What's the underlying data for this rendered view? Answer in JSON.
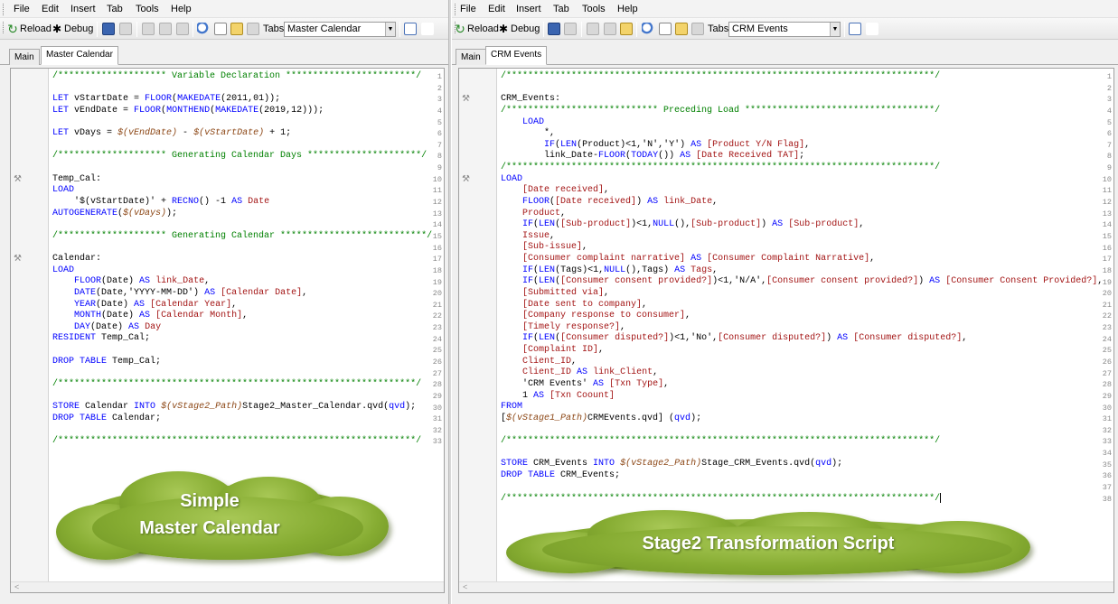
{
  "menu": [
    "File",
    "Edit",
    "Insert",
    "Tab",
    "Tools",
    "Help"
  ],
  "toolbar": {
    "reload_label": "Reload",
    "debug_label": "Debug",
    "tabs_label": "Tabs"
  },
  "left": {
    "combo_value": "Master Calendar",
    "tabs": [
      "Main",
      "Master Calendar"
    ],
    "active_tab": 1,
    "callout": {
      "line1": "Simple",
      "line2": "Master Calendar"
    },
    "wrench_lines": [
      10,
      17
    ],
    "lines": [
      [
        [
          "cm",
          "/******************** Variable Declaration ************************/"
        ]
      ],
      [],
      [
        [
          "kw",
          "LET"
        ],
        [
          "t",
          " vStartDate = "
        ],
        [
          "fn",
          "FLOOR"
        ],
        [
          "t",
          "("
        ],
        [
          "fn",
          "MAKEDATE"
        ],
        [
          "t",
          "(2011,01));"
        ]
      ],
      [
        [
          "kw",
          "LET"
        ],
        [
          "t",
          " vEndDate = "
        ],
        [
          "fn",
          "FLOOR"
        ],
        [
          "t",
          "("
        ],
        [
          "fn",
          "MONTHEND"
        ],
        [
          "t",
          "("
        ],
        [
          "fn",
          "MAKEDATE"
        ],
        [
          "t",
          "(2019,12)));"
        ]
      ],
      [],
      [
        [
          "kw",
          "LET"
        ],
        [
          "t",
          " vDays = "
        ],
        [
          "vr",
          "$(vEndDate)"
        ],
        [
          "t",
          " - "
        ],
        [
          "vr",
          "$(vStartDate)"
        ],
        [
          "t",
          " + 1;"
        ]
      ],
      [],
      [
        [
          "cm",
          "/******************** Generating Calendar Days *********************/"
        ]
      ],
      [],
      [
        [
          "t",
          "Temp_Cal:"
        ]
      ],
      [
        [
          "kw",
          "LOAD"
        ]
      ],
      [
        [
          "t",
          "    '$(vStartDate)' + "
        ],
        [
          "fn",
          "RECNO"
        ],
        [
          "t",
          "() -1 "
        ],
        [
          "kw",
          "AS"
        ],
        [
          "t",
          " "
        ],
        [
          "fld",
          "Date"
        ]
      ],
      [
        [
          "kw",
          "AUTOGENERATE"
        ],
        [
          "t",
          "("
        ],
        [
          "vr",
          "$(vDays)"
        ],
        [
          "t",
          ");"
        ]
      ],
      [],
      [
        [
          "cm",
          "/******************** Generating Calendar ***************************/"
        ]
      ],
      [],
      [
        [
          "t",
          "Calendar:"
        ]
      ],
      [
        [
          "kw",
          "LOAD"
        ]
      ],
      [
        [
          "t",
          "    "
        ],
        [
          "fn",
          "FLOOR"
        ],
        [
          "t",
          "(Date) "
        ],
        [
          "kw",
          "AS"
        ],
        [
          "t",
          " "
        ],
        [
          "fld",
          "link_Date"
        ],
        [
          "t",
          ","
        ]
      ],
      [
        [
          "t",
          "    "
        ],
        [
          "fn",
          "DATE"
        ],
        [
          "t",
          "(Date,'YYYY-MM-DD') "
        ],
        [
          "kw",
          "AS"
        ],
        [
          "t",
          " "
        ],
        [
          "fld",
          "[Calendar Date]"
        ],
        [
          "t",
          ","
        ]
      ],
      [
        [
          "t",
          "    "
        ],
        [
          "fn",
          "YEAR"
        ],
        [
          "t",
          "(Date) "
        ],
        [
          "kw",
          "AS"
        ],
        [
          "t",
          " "
        ],
        [
          "fld",
          "[Calendar Year]"
        ],
        [
          "t",
          ","
        ]
      ],
      [
        [
          "t",
          "    "
        ],
        [
          "fn",
          "MONTH"
        ],
        [
          "t",
          "(Date) "
        ],
        [
          "kw",
          "AS"
        ],
        [
          "t",
          " "
        ],
        [
          "fld",
          "[Calendar Month]"
        ],
        [
          "t",
          ","
        ]
      ],
      [
        [
          "t",
          "    "
        ],
        [
          "fn",
          "DAY"
        ],
        [
          "t",
          "(Date) "
        ],
        [
          "kw",
          "AS"
        ],
        [
          "t",
          " "
        ],
        [
          "fld",
          "Day"
        ]
      ],
      [
        [
          "kw",
          "RESIDENT"
        ],
        [
          "t",
          " Temp_Cal;"
        ]
      ],
      [],
      [
        [
          "kw",
          "DROP TABLE"
        ],
        [
          "t",
          " Temp_Cal;"
        ]
      ],
      [],
      [
        [
          "cm",
          "/******************************************************************/"
        ]
      ],
      [],
      [
        [
          "kw",
          "STORE"
        ],
        [
          "t",
          " Calendar "
        ],
        [
          "kw",
          "INTO"
        ],
        [
          "t",
          " "
        ],
        [
          "vr",
          "$(vStage2_Path)"
        ],
        [
          "t",
          "Stage2_Master_Calendar.qvd("
        ],
        [
          "kw",
          "qvd"
        ],
        [
          "t",
          ");"
        ]
      ],
      [
        [
          "kw",
          "DROP TABLE"
        ],
        [
          "t",
          " Calendar;"
        ]
      ],
      [],
      [
        [
          "cm",
          "/******************************************************************/"
        ]
      ]
    ]
  },
  "right": {
    "combo_value": "CRM Events",
    "tabs": [
      "Main",
      "CRM Events"
    ],
    "active_tab": 1,
    "callout": {
      "line1": "Stage2 Transformation Script"
    },
    "wrench_lines": [
      3,
      10
    ],
    "lines": [
      [
        [
          "cm",
          "/*******************************************************************************/"
        ]
      ],
      [],
      [
        [
          "t",
          "CRM_Events:"
        ]
      ],
      [
        [
          "cm",
          "/**************************** Preceding Load ***********************************/"
        ]
      ],
      [
        [
          "t",
          "    "
        ],
        [
          "kw",
          "LOAD"
        ]
      ],
      [
        [
          "t",
          "        *,"
        ]
      ],
      [
        [
          "t",
          "        "
        ],
        [
          "fn",
          "IF"
        ],
        [
          "t",
          "("
        ],
        [
          "fn",
          "LEN"
        ],
        [
          "t",
          "(Product)<1,'N','Y') "
        ],
        [
          "kw",
          "AS"
        ],
        [
          "t",
          " "
        ],
        [
          "fld",
          "[Product Y/N Flag]"
        ],
        [
          "t",
          ","
        ]
      ],
      [
        [
          "t",
          "        link_Date-"
        ],
        [
          "fn",
          "FLOOR"
        ],
        [
          "t",
          "("
        ],
        [
          "fn",
          "TODAY"
        ],
        [
          "t",
          "()) "
        ],
        [
          "kw",
          "AS"
        ],
        [
          "t",
          " "
        ],
        [
          "fld",
          "[Date Received TAT]"
        ],
        [
          "t",
          ";"
        ]
      ],
      [
        [
          "cm",
          "/*******************************************************************************/"
        ]
      ],
      [
        [
          "kw",
          "LOAD"
        ]
      ],
      [
        [
          "t",
          "    "
        ],
        [
          "fld",
          "[Date received]"
        ],
        [
          "t",
          ","
        ]
      ],
      [
        [
          "t",
          "    "
        ],
        [
          "fn",
          "FLOOR"
        ],
        [
          "t",
          "("
        ],
        [
          "fld",
          "[Date received]"
        ],
        [
          "t",
          ") "
        ],
        [
          "kw",
          "AS"
        ],
        [
          "t",
          " "
        ],
        [
          "fld",
          "link_Date"
        ],
        [
          "t",
          ","
        ]
      ],
      [
        [
          "t",
          "    "
        ],
        [
          "fld",
          "Product"
        ],
        [
          "t",
          ","
        ]
      ],
      [
        [
          "t",
          "    "
        ],
        [
          "fn",
          "IF"
        ],
        [
          "t",
          "("
        ],
        [
          "fn",
          "LEN"
        ],
        [
          "t",
          "("
        ],
        [
          "fld",
          "[Sub-product]"
        ],
        [
          "t",
          ")<1,"
        ],
        [
          "fn",
          "NULL"
        ],
        [
          "t",
          "(),"
        ],
        [
          "fld",
          "[Sub-product]"
        ],
        [
          "t",
          ") "
        ],
        [
          "kw",
          "AS"
        ],
        [
          "t",
          " "
        ],
        [
          "fld",
          "[Sub-product]"
        ],
        [
          "t",
          ","
        ]
      ],
      [
        [
          "t",
          "    "
        ],
        [
          "fld",
          "Issue"
        ],
        [
          "t",
          ","
        ]
      ],
      [
        [
          "t",
          "    "
        ],
        [
          "fld",
          "[Sub-issue]"
        ],
        [
          "t",
          ","
        ]
      ],
      [
        [
          "t",
          "    "
        ],
        [
          "fld",
          "[Consumer complaint narrative]"
        ],
        [
          "t",
          " "
        ],
        [
          "kw",
          "AS"
        ],
        [
          "t",
          " "
        ],
        [
          "fld",
          "[Consumer Complaint Narrative]"
        ],
        [
          "t",
          ","
        ]
      ],
      [
        [
          "t",
          "    "
        ],
        [
          "fn",
          "IF"
        ],
        [
          "t",
          "("
        ],
        [
          "fn",
          "LEN"
        ],
        [
          "t",
          "(Tags)<1,"
        ],
        [
          "fn",
          "NULL"
        ],
        [
          "t",
          "(),Tags) "
        ],
        [
          "kw",
          "AS"
        ],
        [
          "t",
          " "
        ],
        [
          "fld",
          "Tags"
        ],
        [
          "t",
          ","
        ]
      ],
      [
        [
          "t",
          "    "
        ],
        [
          "fn",
          "IF"
        ],
        [
          "t",
          "("
        ],
        [
          "fn",
          "LEN"
        ],
        [
          "t",
          "("
        ],
        [
          "fld",
          "[Consumer consent provided?]"
        ],
        [
          "t",
          ")<1,'N/A',"
        ],
        [
          "fld",
          "[Consumer consent provided?]"
        ],
        [
          "t",
          ") "
        ],
        [
          "kw",
          "AS"
        ],
        [
          "t",
          " "
        ],
        [
          "fld",
          "[Consumer Consent Provided?]"
        ],
        [
          "t",
          ","
        ]
      ],
      [
        [
          "t",
          "    "
        ],
        [
          "fld",
          "[Submitted via]"
        ],
        [
          "t",
          ","
        ]
      ],
      [
        [
          "t",
          "    "
        ],
        [
          "fld",
          "[Date sent to company]"
        ],
        [
          "t",
          ","
        ]
      ],
      [
        [
          "t",
          "    "
        ],
        [
          "fld",
          "[Company response to consumer]"
        ],
        [
          "t",
          ","
        ]
      ],
      [
        [
          "t",
          "    "
        ],
        [
          "fld",
          "[Timely response?]"
        ],
        [
          "t",
          ","
        ]
      ],
      [
        [
          "t",
          "    "
        ],
        [
          "fn",
          "IF"
        ],
        [
          "t",
          "("
        ],
        [
          "fn",
          "LEN"
        ],
        [
          "t",
          "("
        ],
        [
          "fld",
          "[Consumer disputed?]"
        ],
        [
          "t",
          ")<1,'No',"
        ],
        [
          "fld",
          "[Consumer disputed?]"
        ],
        [
          "t",
          ") "
        ],
        [
          "kw",
          "AS"
        ],
        [
          "t",
          " "
        ],
        [
          "fld",
          "[Consumer disputed?]"
        ],
        [
          "t",
          ","
        ]
      ],
      [
        [
          "t",
          "    "
        ],
        [
          "fld",
          "[Complaint ID]"
        ],
        [
          "t",
          ","
        ]
      ],
      [
        [
          "t",
          "    "
        ],
        [
          "fld",
          "Client_ID"
        ],
        [
          "t",
          ","
        ]
      ],
      [
        [
          "t",
          "    "
        ],
        [
          "fld",
          "Client_ID"
        ],
        [
          "t",
          " "
        ],
        [
          "kw",
          "AS"
        ],
        [
          "t",
          " "
        ],
        [
          "fld",
          "link_Client"
        ],
        [
          "t",
          ","
        ]
      ],
      [
        [
          "t",
          "    'CRM Events' "
        ],
        [
          "kw",
          "AS"
        ],
        [
          "t",
          " "
        ],
        [
          "fld",
          "[Txn Type]"
        ],
        [
          "t",
          ","
        ]
      ],
      [
        [
          "t",
          "    1 "
        ],
        [
          "kw",
          "AS"
        ],
        [
          "t",
          " "
        ],
        [
          "fld",
          "[Txn Coount]"
        ]
      ],
      [
        [
          "kw",
          "FROM"
        ]
      ],
      [
        [
          "t",
          "["
        ],
        [
          "vr",
          "$(vStage1_Path)"
        ],
        [
          "t",
          "CRMEvents.qvd] ("
        ],
        [
          "kw",
          "qvd"
        ],
        [
          "t",
          ");"
        ]
      ],
      [],
      [
        [
          "cm",
          "/*******************************************************************************/"
        ]
      ],
      [],
      [
        [
          "kw",
          "STORE"
        ],
        [
          "t",
          " CRM_Events "
        ],
        [
          "kw",
          "INTO"
        ],
        [
          "t",
          " "
        ],
        [
          "vr",
          "$(vStage2_Path)"
        ],
        [
          "t",
          "Stage_CRM_Events.qvd("
        ],
        [
          "kw",
          "qvd"
        ],
        [
          "t",
          ");"
        ]
      ],
      [
        [
          "kw",
          "DROP TABLE"
        ],
        [
          "t",
          " CRM_Events;"
        ]
      ],
      [],
      [
        [
          "cm",
          "/*******************************************************************************/"
        ],
        [
          "caret",
          ""
        ]
      ]
    ]
  },
  "colors": {
    "keyword": "#0000ff",
    "comment": "#008000",
    "field": "#a31515",
    "variable": "#8b4513",
    "cloud": "#86ac32"
  }
}
